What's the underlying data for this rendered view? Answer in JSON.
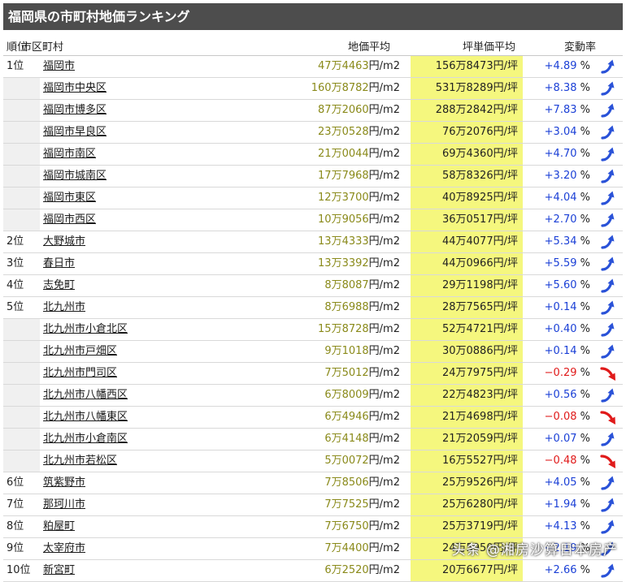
{
  "title": "福岡県の市町村地価ランキング",
  "headers": {
    "rank": "順位",
    "name": "市区町村",
    "land": "地価平均",
    "tsubo": "坪単価平均",
    "change": "変動率"
  },
  "units": {
    "land": "円/m2",
    "tsubo": "円/坪",
    "pct": "%"
  },
  "colors": {
    "header_bg": "#4d4d4d",
    "tsubo_bg": "#f5f77e",
    "positive": "#1a3fd6",
    "negative": "#e01a1a",
    "land_value": "#8a8a1a"
  },
  "rows": [
    {
      "rank": "1位",
      "name": "福岡市",
      "land": "47万4463",
      "tsubo": "156万8473",
      "change": "+4.89",
      "trend": "up",
      "sub": false
    },
    {
      "rank": "",
      "name": "福岡市中央区",
      "land": "160万8782",
      "tsubo": "531万8289",
      "change": "+8.38",
      "trend": "up",
      "sub": true
    },
    {
      "rank": "",
      "name": "福岡市博多区",
      "land": "87万2060",
      "tsubo": "288万2842",
      "change": "+7.83",
      "trend": "up",
      "sub": true
    },
    {
      "rank": "",
      "name": "福岡市早良区",
      "land": "23万0528",
      "tsubo": "76万2076",
      "change": "+3.04",
      "trend": "up",
      "sub": true
    },
    {
      "rank": "",
      "name": "福岡市南区",
      "land": "21万0044",
      "tsubo": "69万4360",
      "change": "+4.70",
      "trend": "up",
      "sub": true
    },
    {
      "rank": "",
      "name": "福岡市城南区",
      "land": "17万7968",
      "tsubo": "58万8326",
      "change": "+3.20",
      "trend": "up",
      "sub": true
    },
    {
      "rank": "",
      "name": "福岡市東区",
      "land": "12万3700",
      "tsubo": "40万8925",
      "change": "+4.04",
      "trend": "up",
      "sub": true
    },
    {
      "rank": "",
      "name": "福岡市西区",
      "land": "10万9056",
      "tsubo": "36万0517",
      "change": "+2.70",
      "trend": "up",
      "sub": true
    },
    {
      "rank": "2位",
      "name": "大野城市",
      "land": "13万4333",
      "tsubo": "44万4077",
      "change": "+5.34",
      "trend": "up",
      "sub": false
    },
    {
      "rank": "3位",
      "name": "春日市",
      "land": "13万3392",
      "tsubo": "44万0966",
      "change": "+5.59",
      "trend": "up",
      "sub": false
    },
    {
      "rank": "4位",
      "name": "志免町",
      "land": "8万8087",
      "tsubo": "29万1198",
      "change": "+5.60",
      "trend": "up",
      "sub": false
    },
    {
      "rank": "5位",
      "name": "北九州市",
      "land": "8万6988",
      "tsubo": "28万7565",
      "change": "+0.14",
      "trend": "up",
      "sub": false
    },
    {
      "rank": "",
      "name": "北九州市小倉北区",
      "land": "15万8728",
      "tsubo": "52万4721",
      "change": "+0.40",
      "trend": "up",
      "sub": true
    },
    {
      "rank": "",
      "name": "北九州市戸畑区",
      "land": "9万1018",
      "tsubo": "30万0886",
      "change": "+0.14",
      "trend": "up",
      "sub": true
    },
    {
      "rank": "",
      "name": "北九州市門司区",
      "land": "7万5012",
      "tsubo": "24万7975",
      "change": "−0.29",
      "trend": "down",
      "sub": true
    },
    {
      "rank": "",
      "name": "北九州市八幡西区",
      "land": "6万8009",
      "tsubo": "22万4823",
      "change": "+0.56",
      "trend": "up",
      "sub": true
    },
    {
      "rank": "",
      "name": "北九州市八幡東区",
      "land": "6万4946",
      "tsubo": "21万4698",
      "change": "−0.08",
      "trend": "down",
      "sub": true
    },
    {
      "rank": "",
      "name": "北九州市小倉南区",
      "land": "6万4148",
      "tsubo": "21万2059",
      "change": "+0.07",
      "trend": "up",
      "sub": true
    },
    {
      "rank": "",
      "name": "北九州市若松区",
      "land": "5万0072",
      "tsubo": "16万5527",
      "change": "−0.48",
      "trend": "down",
      "sub": true
    },
    {
      "rank": "6位",
      "name": "筑紫野市",
      "land": "7万8506",
      "tsubo": "25万9526",
      "change": "+4.05",
      "trend": "up",
      "sub": false
    },
    {
      "rank": "7位",
      "name": "那珂川市",
      "land": "7万7525",
      "tsubo": "25万6280",
      "change": "+1.94",
      "trend": "up",
      "sub": false
    },
    {
      "rank": "8位",
      "name": "粕屋町",
      "land": "7万6750",
      "tsubo": "25万3719",
      "change": "+4.13",
      "trend": "up",
      "sub": false
    },
    {
      "rank": "9位",
      "name": "太宰府市",
      "land": "7万4400",
      "tsubo": "24万5950",
      "change": "+2.19",
      "trend": "up",
      "sub": false
    },
    {
      "rank": "10位",
      "name": "新宮町",
      "land": "6万2520",
      "tsubo": "20万6677",
      "change": "+2.66",
      "trend": "up",
      "sub": false
    }
  ],
  "watermark": "头条 @湘房沙算日本房产"
}
